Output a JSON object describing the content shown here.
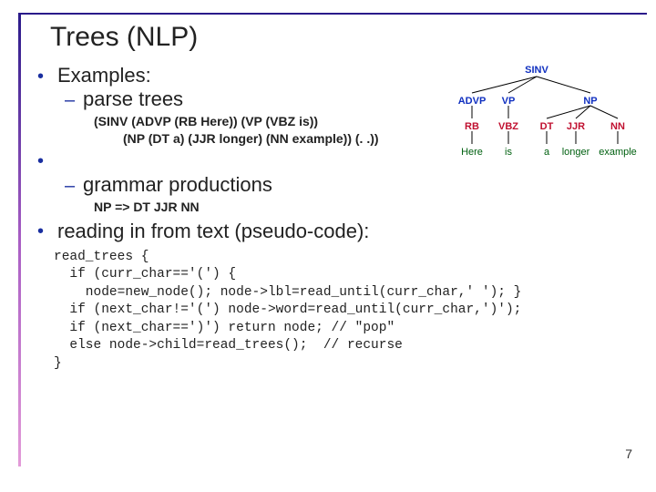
{
  "title": "Trees (NLP)",
  "bullets": {
    "examples": "Examples:",
    "parse_trees": "parse trees",
    "sinv_line1": "(SINV (ADVP (RB Here)) (VP (VBZ is))",
    "sinv_line2": "(NP (DT a) (JJR longer) (NN example)) (. .))",
    "grammar_prod": "grammar productions",
    "np_rule": "NP => DT JJR NN",
    "reading": "reading in from text (pseudo-code):"
  },
  "code": {
    "l1": "read_trees {",
    "l2": "  if (curr_char=='(') {",
    "l3": "    node=new_node(); node->lbl=read_until(curr_char,' '); }",
    "l4": "  if (next_char!='(') node->word=read_until(curr_char,')');",
    "l5": "  if (next_char==')') return node; // \"pop\"",
    "l6": "  else node->child=read_trees();  // recurse",
    "l7": "}"
  },
  "tree": {
    "root": "SINV",
    "n_advp": "ADVP",
    "n_vp": "VP",
    "n_np": "NP",
    "n_rb": "RB",
    "n_vbz": "VBZ",
    "n_dt": "DT",
    "n_jjr": "JJR",
    "n_nn": "NN",
    "w_here": "Here",
    "w_is": "is",
    "w_a": "a",
    "w_longer": "longer",
    "w_example": "example"
  },
  "page_number": "7"
}
